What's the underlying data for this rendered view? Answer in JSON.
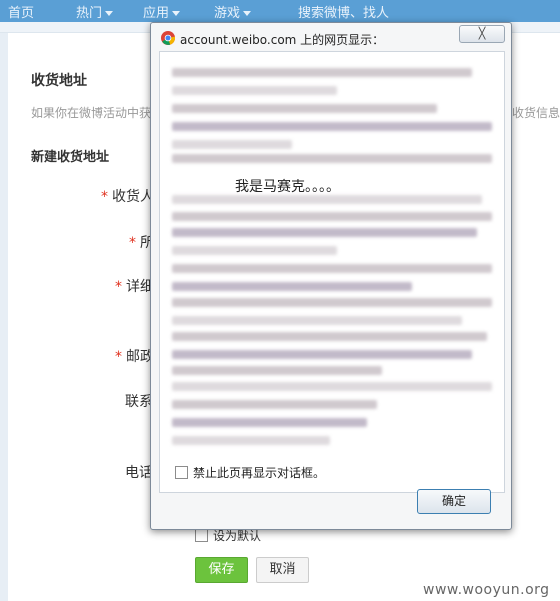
{
  "topnav": {
    "items": [
      "首页",
      "热门",
      "应用",
      "游戏",
      "搜索微博、找人"
    ]
  },
  "page": {
    "title": "收货地址",
    "desc_left": "如果你在微博活动中获",
    "desc_right": "收货信息",
    "section_title": "新建收货地址"
  },
  "form": {
    "labels": [
      "收货人",
      "所",
      "详细",
      "邮政",
      "联系",
      "电话"
    ],
    "set_default": "设为默认",
    "save": "保存",
    "cancel": "取消"
  },
  "dialog": {
    "title": "account.weibo.com 上的网页显示：",
    "close": "╳",
    "message": "我是马赛克。。。。",
    "suppress_checkbox": "禁止此页再显示对话框。",
    "ok": "确定"
  },
  "watermark": "www.wooyun.org",
  "colors": {
    "nav_bg": "#5a9fd5",
    "save_green": "#6cc33d",
    "required_red": "#e0311f"
  }
}
